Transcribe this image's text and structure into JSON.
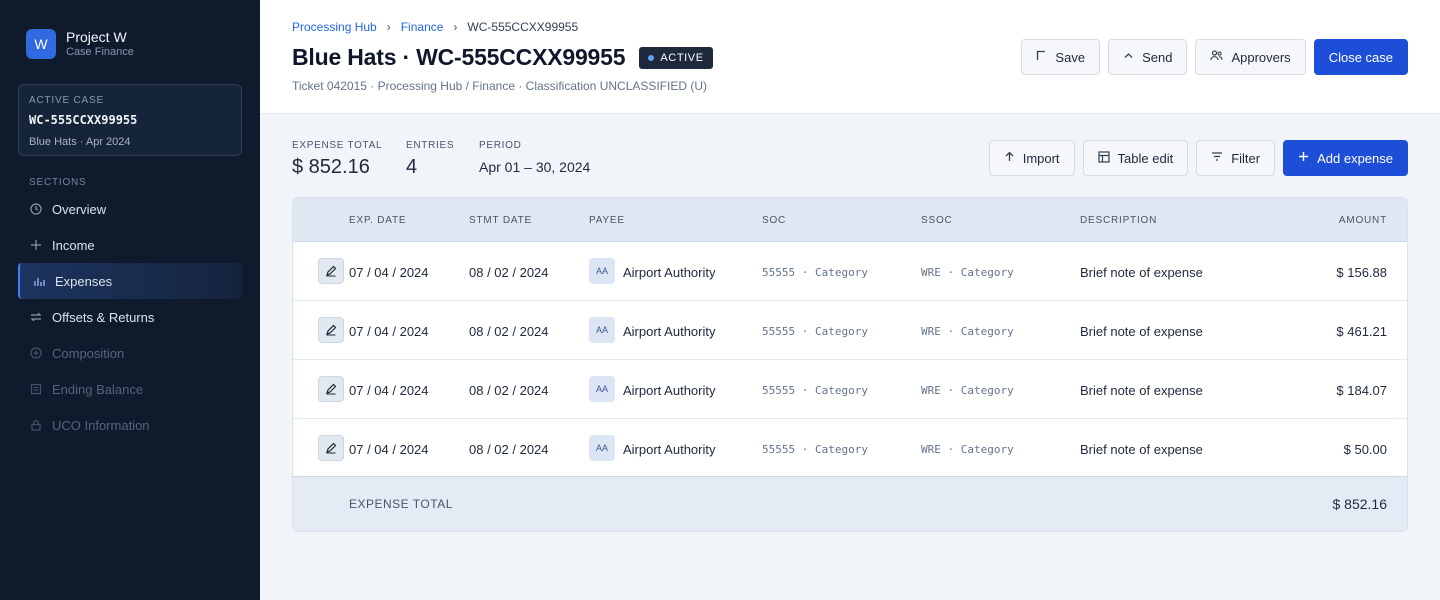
{
  "app": {
    "logo_letter": "W",
    "name": "Project W",
    "subtitle": "Case Finance"
  },
  "active_case": {
    "label": "ACTIVE CASE",
    "id": "WC-555CCXX99955",
    "meta": "Blue Hats · Apr 2024"
  },
  "sidebar": {
    "sections_label": "SECTIONS",
    "items": [
      {
        "label": "Overview",
        "icon": "clock-icon",
        "state": "normal"
      },
      {
        "label": "Income",
        "icon": "plus-icon",
        "state": "normal"
      },
      {
        "label": "Expenses",
        "icon": "bar-chart-icon",
        "state": "active"
      },
      {
        "label": "Offsets & Returns",
        "icon": "swap-icon",
        "state": "normal"
      },
      {
        "label": "Composition",
        "icon": "circle-plus-icon",
        "state": "disabled"
      },
      {
        "label": "Ending Balance",
        "icon": "ledger-icon",
        "state": "disabled"
      },
      {
        "label": "UCO Information",
        "icon": "lock-icon",
        "state": "disabled"
      }
    ]
  },
  "breadcrumb": {
    "items": [
      "Processing Hub",
      "Finance"
    ],
    "current": "WC-555CCXX99955",
    "separator": "›"
  },
  "header": {
    "title": "Blue Hats · WC-555CCXX99955",
    "status": "ACTIVE",
    "subline": "Ticket 042015 · Processing Hub / Finance · Classification UNCLASSIFIED (U)",
    "actions": {
      "save": "Save",
      "send": "Send",
      "approvers": "Approvers",
      "close": "Close case"
    }
  },
  "summary": {
    "expense_total_label": "EXPENSE TOTAL",
    "expense_total": "$ 852.16",
    "entries_label": "ENTRIES",
    "entries": "4",
    "period_label": "PERIOD",
    "period": "Apr 01 – 30, 2024"
  },
  "table_actions": {
    "import": "Import",
    "table_edit": "Table edit",
    "filter": "Filter",
    "add": "Add expense"
  },
  "table": {
    "columns": {
      "exp_date": "EXP. DATE",
      "stmt_date": "STMT DATE",
      "payee": "PAYEE",
      "soc": "SOC",
      "ssoc": "SSOC",
      "description": "DESCRIPTION",
      "amount": "AMOUNT"
    },
    "rows": [
      {
        "exp_date": "07 / 04 / 2024",
        "stmt_date": "08 / 02 / 2024",
        "payee_initials": "AA",
        "payee": "Airport Authority",
        "soc": "55555 · Category",
        "ssoc": "WRE · Category",
        "description": "Brief note of expense",
        "amount": "$ 156.88"
      },
      {
        "exp_date": "07 / 04 / 2024",
        "stmt_date": "08 / 02 / 2024",
        "payee_initials": "AA",
        "payee": "Airport Authority",
        "soc": "55555 · Category",
        "ssoc": "WRE · Category",
        "description": "Brief note of expense",
        "amount": "$ 461.21"
      },
      {
        "exp_date": "07 / 04 / 2024",
        "stmt_date": "08 / 02 / 2024",
        "payee_initials": "AA",
        "payee": "Airport Authority",
        "soc": "55555 · Category",
        "ssoc": "WRE · Category",
        "description": "Brief note of expense",
        "amount": "$ 184.07"
      },
      {
        "exp_date": "07 / 04 / 2024",
        "stmt_date": "08 / 02 / 2024",
        "payee_initials": "AA",
        "payee": "Airport Authority",
        "soc": "55555 · Category",
        "ssoc": "WRE · Category",
        "description": "Brief note of expense",
        "amount": "$ 50.00"
      }
    ],
    "footer": {
      "label": "EXPENSE TOTAL",
      "value": "$ 852.16"
    }
  },
  "colors": {
    "sidebar_bg": "#0f1b2d",
    "accent": "#1d4ed8",
    "link": "#2563eb",
    "active_indicator": "#3b82f6"
  }
}
